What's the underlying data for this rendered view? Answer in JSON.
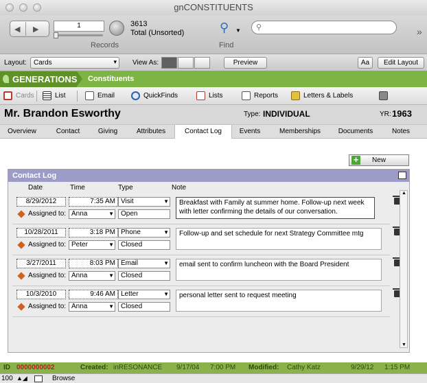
{
  "window": {
    "title": "gnCONSTITUENTS"
  },
  "toolbar": {
    "record_number": "1",
    "total_count": "3613",
    "total_label": "Total (Unsorted)",
    "records_label": "Records",
    "find_label": "Find",
    "search_placeholder": ""
  },
  "layoutbar": {
    "layout_label": "Layout:",
    "layout_value": "Cards",
    "viewas_label": "View As:",
    "preview_label": "Preview",
    "aa_label": "Aa",
    "edit_layout_label": "Edit Layout"
  },
  "brand": {
    "name": "GENERATIONS",
    "section": "Constituents",
    "color": "#7eb443"
  },
  "nav": {
    "items": [
      {
        "label": "Cards",
        "icon": "cards-icon"
      },
      {
        "label": "List",
        "icon": "list-icon"
      },
      {
        "label": "Email",
        "icon": "email-icon"
      },
      {
        "label": "QuickFinds",
        "icon": "magnifier-icon"
      },
      {
        "label": "Lists",
        "icon": "lists-icon"
      },
      {
        "label": "Reports",
        "icon": "reports-icon"
      },
      {
        "label": "Letters & Labels",
        "icon": "pencil-icon"
      }
    ]
  },
  "record": {
    "name": "Mr. Brandon Esworthy",
    "type_label": "Type:",
    "type_value": "INDIVIDUAL",
    "yr_label": "YR:",
    "yr_value": "1963"
  },
  "tabs": [
    "Overview",
    "Contact",
    "Giving",
    "Attributes",
    "Contact Log",
    "Events",
    "Memberships",
    "Documents",
    "Notes"
  ],
  "active_tab": "Contact Log",
  "contact_log": {
    "title": "Contact Log",
    "new_label": "New",
    "headers": {
      "date": "Date",
      "time": "Time",
      "type": "Type",
      "note": "Note"
    },
    "assigned_label": "Assigned to:",
    "entries": [
      {
        "date": "8/29/2012",
        "time": "7:35 AM",
        "type": "Visit",
        "assigned": "Anna",
        "status": "Open",
        "note": "Breakfast with Family at summer home. Follow-up next week with letter confirming the details of our conversation."
      },
      {
        "date": "10/28/2011",
        "time": "3:18 PM",
        "type": "Phone",
        "assigned": "Peter",
        "status": "Closed",
        "note": "Follow-up and set schedule for next Strategy Committee mtg"
      },
      {
        "date": "3/27/2011",
        "time": "8:03 PM",
        "type": "Email",
        "assigned": "Anna",
        "status": "Closed",
        "note": "email sent to confirm luncheon with the Board President"
      },
      {
        "date": "10/3/2010",
        "time": "9:46 AM",
        "type": "Letter",
        "assigned": "Anna",
        "status": "Closed",
        "note": "personal letter sent to request meeting"
      }
    ]
  },
  "status": {
    "id_label": "ID",
    "id_value": "0000000002",
    "created_label": "Created:",
    "created_by": "inRESONANCE",
    "created_date": "9/17/04",
    "created_time": "7:00 PM",
    "modified_label": "Modified:",
    "modified_by": "Cathy Katz",
    "modified_date": "9/29/12",
    "modified_time": "1:15 PM"
  },
  "bottom": {
    "zoom": "100",
    "mode": "Browse"
  }
}
